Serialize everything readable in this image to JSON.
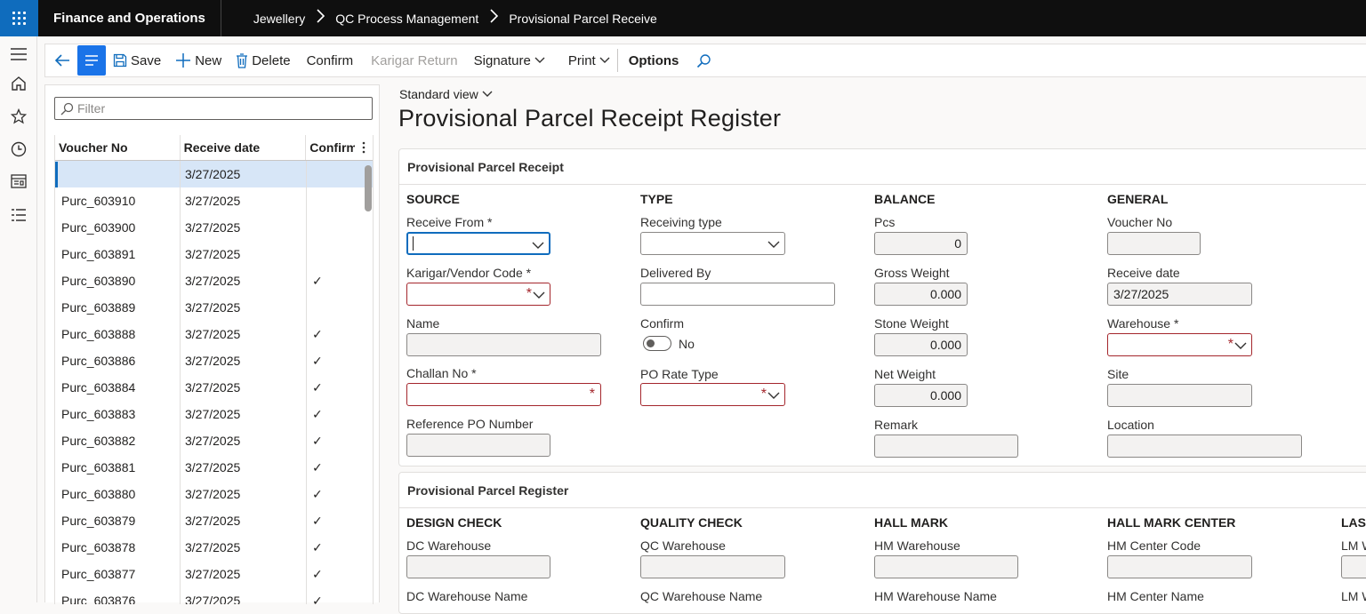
{
  "topbar": {
    "app_title": "Finance and Operations",
    "breadcrumbs": [
      "Jewellery",
      "QC Process Management",
      "Provisional Parcel Receive"
    ]
  },
  "rail": {
    "icons": [
      "hamburger-icon",
      "home-icon",
      "star-icon",
      "clock-icon",
      "workspace-icon",
      "list-icon"
    ]
  },
  "toolbar": {
    "save": "Save",
    "new": "New",
    "delete": "Delete",
    "confirm": "Confirm",
    "karigar_return": "Karigar Return",
    "signature": "Signature",
    "print": "Print",
    "options": "Options"
  },
  "list": {
    "filter_placeholder": "Filter",
    "columns": [
      "Voucher No",
      "Receive date",
      "Confirm"
    ],
    "rows": [
      {
        "voucher": "",
        "date": "3/27/2025",
        "confirm": ""
      },
      {
        "voucher": "Purc_603910",
        "date": "3/27/2025",
        "confirm": ""
      },
      {
        "voucher": "Purc_603900",
        "date": "3/27/2025",
        "confirm": ""
      },
      {
        "voucher": "Purc_603891",
        "date": "3/27/2025",
        "confirm": ""
      },
      {
        "voucher": "Purc_603890",
        "date": "3/27/2025",
        "confirm": "✓"
      },
      {
        "voucher": "Purc_603889",
        "date": "3/27/2025",
        "confirm": ""
      },
      {
        "voucher": "Purc_603888",
        "date": "3/27/2025",
        "confirm": "✓"
      },
      {
        "voucher": "Purc_603886",
        "date": "3/27/2025",
        "confirm": "✓"
      },
      {
        "voucher": "Purc_603884",
        "date": "3/27/2025",
        "confirm": "✓"
      },
      {
        "voucher": "Purc_603883",
        "date": "3/27/2025",
        "confirm": "✓"
      },
      {
        "voucher": "Purc_603882",
        "date": "3/27/2025",
        "confirm": "✓"
      },
      {
        "voucher": "Purc_603881",
        "date": "3/27/2025",
        "confirm": "✓"
      },
      {
        "voucher": "Purc_603880",
        "date": "3/27/2025",
        "confirm": "✓"
      },
      {
        "voucher": "Purc_603879",
        "date": "3/27/2025",
        "confirm": "✓"
      },
      {
        "voucher": "Purc_603878",
        "date": "3/27/2025",
        "confirm": "✓"
      },
      {
        "voucher": "Purc_603877",
        "date": "3/27/2025",
        "confirm": "✓"
      },
      {
        "voucher": "Purc_603876",
        "date": "3/27/2025",
        "confirm": "✓"
      }
    ]
  },
  "main": {
    "view": "Standard view",
    "title": "Provisional Parcel Receipt Register"
  },
  "receipt": {
    "card_title": "Provisional Parcel Receipt",
    "source": {
      "heading": "SOURCE",
      "receive_from": "Receive From *",
      "vendor_code": "Karigar/Vendor Code *",
      "name": "Name",
      "challan_no": "Challan No *",
      "reference_po": "Reference PO Number"
    },
    "type": {
      "heading": "TYPE",
      "receiving_type": "Receiving type",
      "delivered_by": "Delivered By",
      "confirm": "Confirm",
      "confirm_value": "No",
      "po_rate_type": "PO Rate Type"
    },
    "balance": {
      "heading": "BALANCE",
      "pcs": "Pcs",
      "pcs_value": "0",
      "gross_weight": "Gross Weight",
      "gross_weight_value": "0.000",
      "stone_weight": "Stone Weight",
      "stone_weight_value": "0.000",
      "net_weight": "Net Weight",
      "net_weight_value": "0.000",
      "remark": "Remark"
    },
    "general": {
      "heading": "GENERAL",
      "voucher_no": "Voucher No",
      "receive_date": "Receive date",
      "receive_date_value": "3/27/2025",
      "warehouse": "Warehouse *",
      "site": "Site",
      "location": "Location"
    }
  },
  "register": {
    "card_title": "Provisional Parcel Register",
    "design_check": {
      "heading": "DESIGN CHECK",
      "warehouse": "DC Warehouse",
      "warehouse_name": "DC Warehouse Name"
    },
    "quality_check": {
      "heading": "QUALITY CHECK",
      "warehouse": "QC Warehouse",
      "warehouse_name": "QC Warehouse Name"
    },
    "hall_mark": {
      "heading": "HALL MARK",
      "warehouse": "HM Warehouse",
      "warehouse_name": "HM Warehouse Name"
    },
    "hall_mark_center": {
      "heading": "HALL MARK CENTER",
      "code": "HM Center Code",
      "name": "HM Center Name"
    },
    "laser": {
      "heading": "LASE",
      "warehouse": "LM W",
      "warehouse_name": "LM W"
    }
  },
  "colors": {
    "accent": "#0f6cbd",
    "required": "#a4262c",
    "topbar": "#0f0f0f"
  }
}
